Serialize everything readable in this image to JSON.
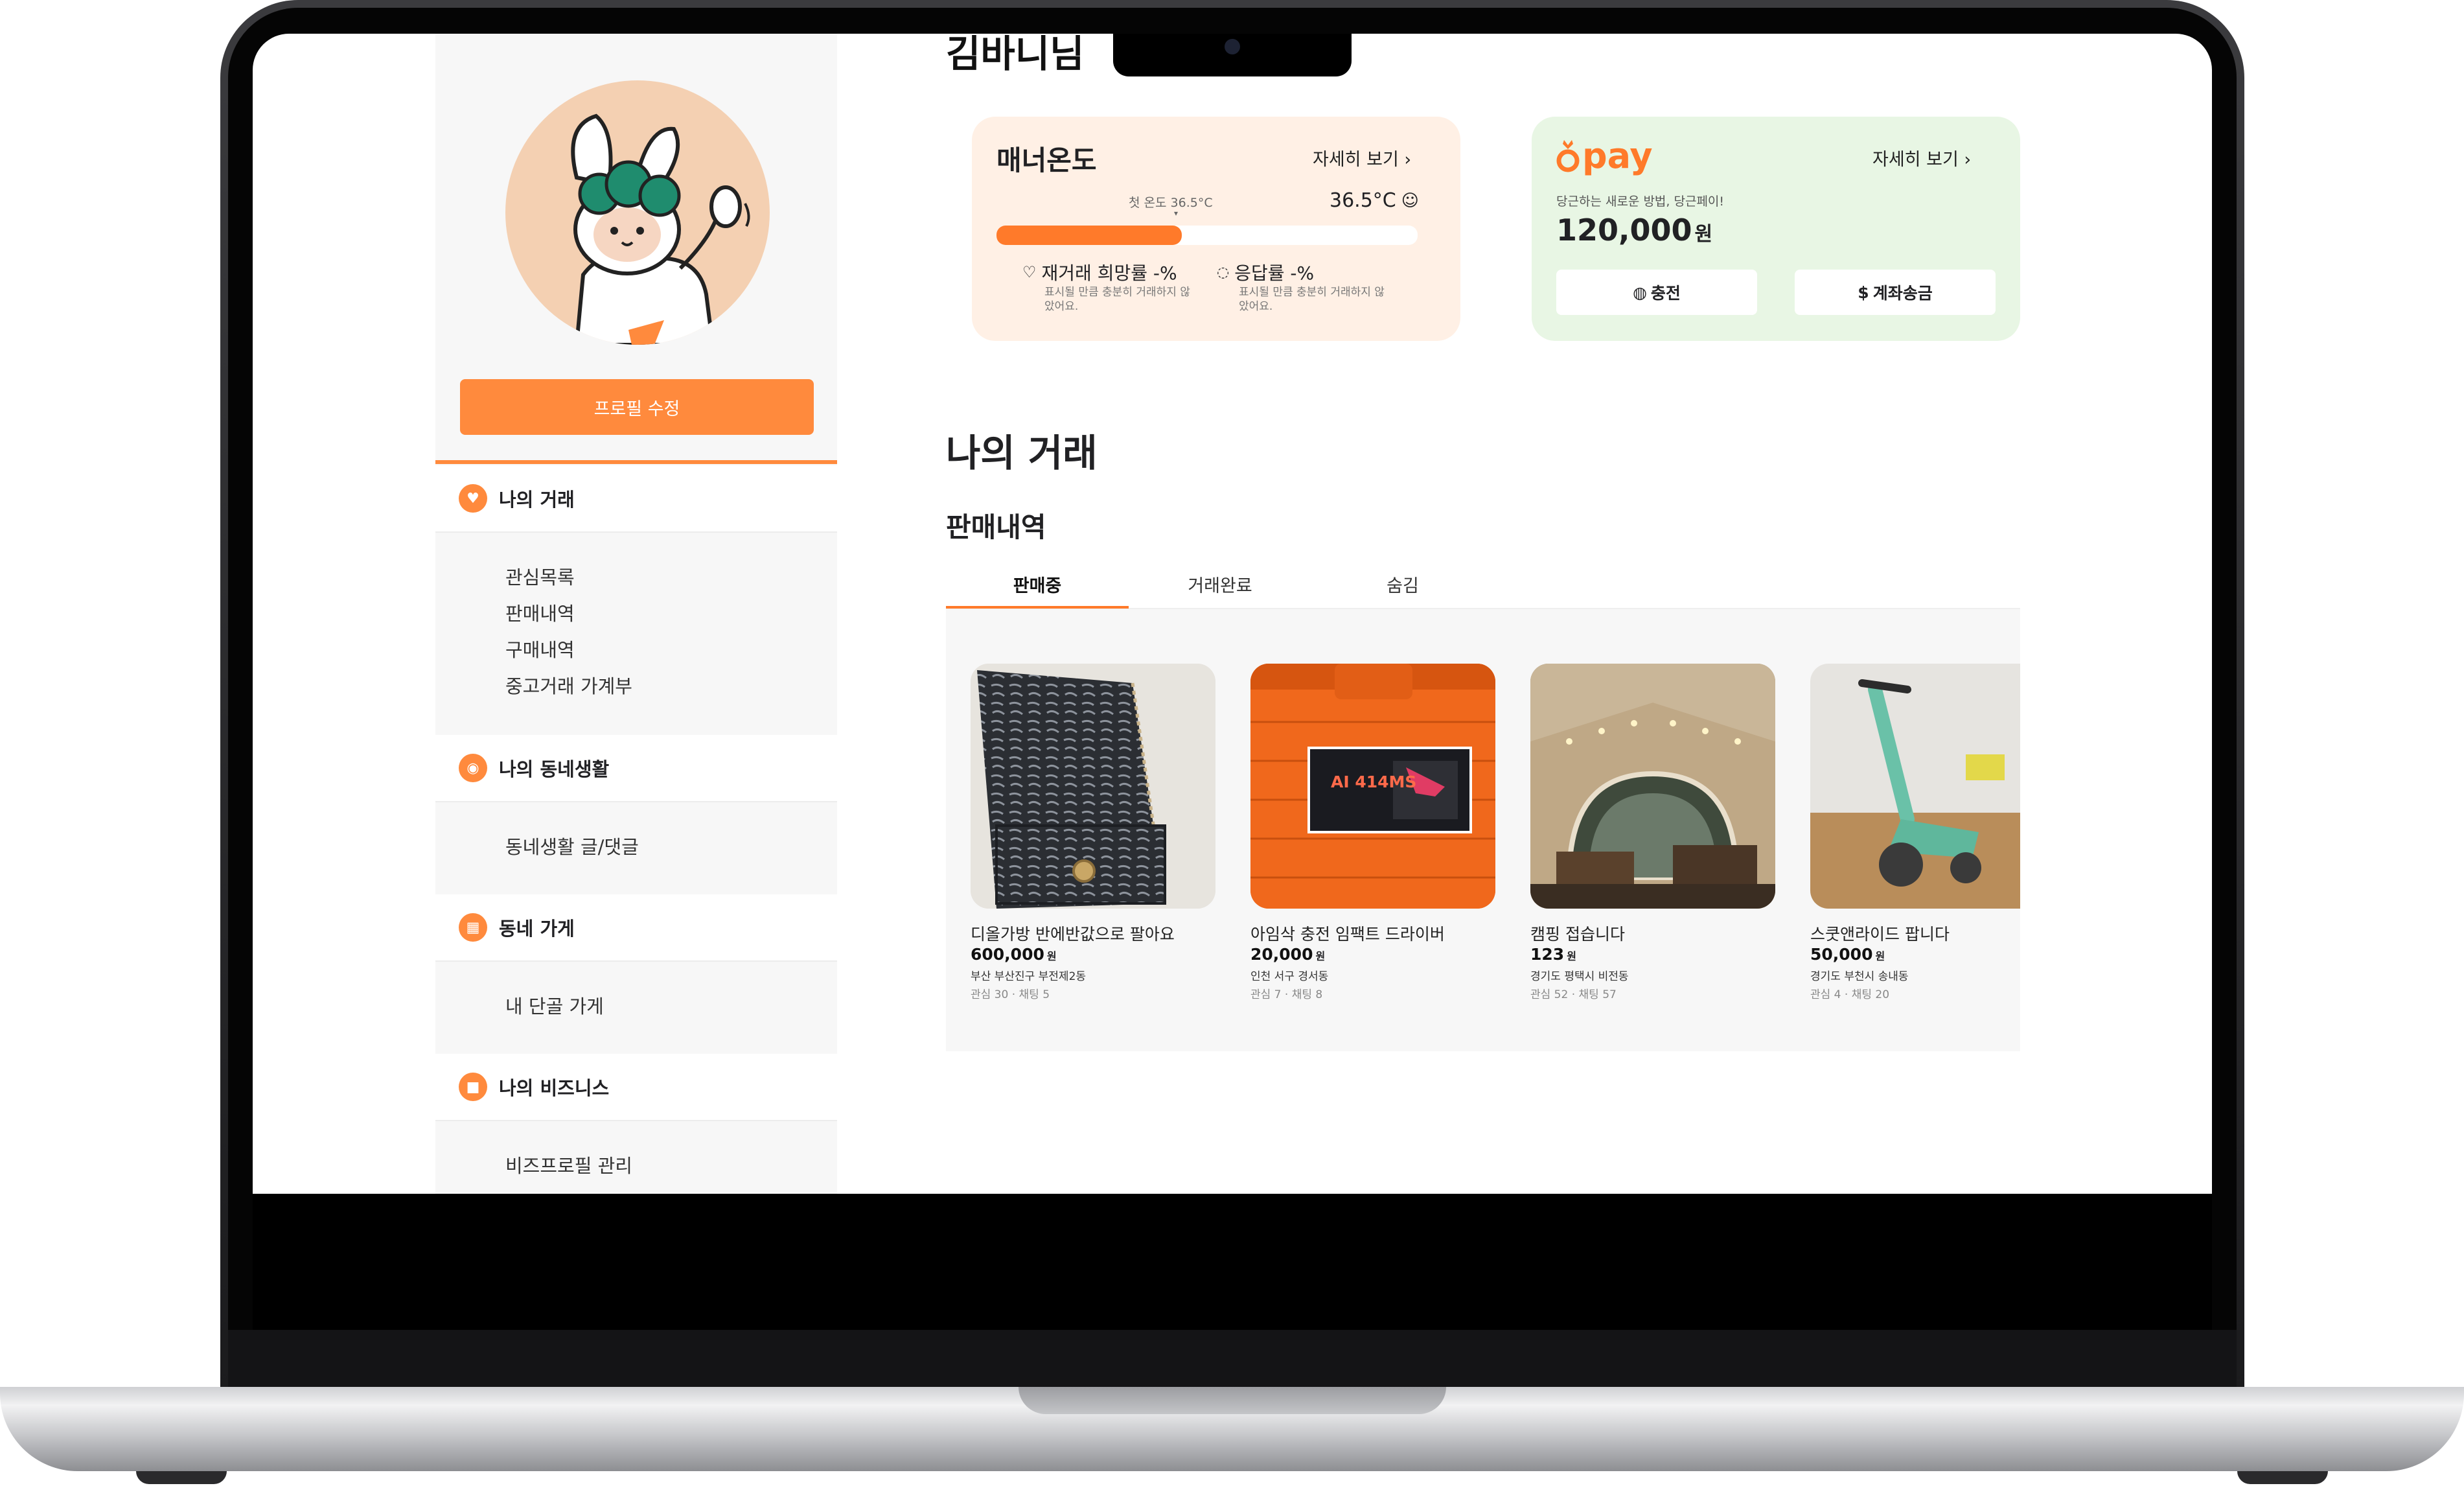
{
  "profile": {
    "greeting": "김바니님",
    "edit_button": "프로필 수정"
  },
  "sidebar": {
    "sections": [
      {
        "title": "나의 거래",
        "items": [
          "관심목록",
          "판매내역",
          "구매내역",
          "중고거래 가계부"
        ]
      },
      {
        "title": "나의 동네생활",
        "items": [
          "동네생활 글/댓글"
        ]
      },
      {
        "title": "동네 가게",
        "items": [
          "내 단골 가게"
        ]
      },
      {
        "title": "나의 비즈니스",
        "items": [
          "비즈프로필 관리"
        ]
      }
    ]
  },
  "manner": {
    "title": "매너온도",
    "more": "자세히 보기",
    "first_temp_label": "첫 온도 36.5°C",
    "temperature": "36.5°C",
    "temperature_level": 0.44,
    "rebuy_label": "재거래 희망률 -%",
    "rebuy_note": "표시될 만큼 충분히 거래하지 않았어요.",
    "response_label": "응답률 -%",
    "response_note": "표시될 만큼 충분히 거래하지 않았어요."
  },
  "pay": {
    "logo": "pay",
    "more": "자세히 보기",
    "tagline": "당근하는 새로운 방법, 당근페이!",
    "balance": "120,000",
    "currency": "원",
    "charge_button": "충전",
    "transfer_button": "계좌송금"
  },
  "trades": {
    "section_title": "나의 거래",
    "sales_title": "판매내역",
    "tabs": [
      "판매중",
      "거래완료",
      "숨김"
    ],
    "active_tab": 0,
    "listings": [
      {
        "title": "디올가방 반에반값으로 팔아요",
        "price": "600,000",
        "unit": "원",
        "location": "부산 부산진구 부전제2동",
        "meta": "관심 30 · 채팅 5",
        "image": "bag-image"
      },
      {
        "title": "아임삭 충전 임팩트 드라이버",
        "price": "20,000",
        "unit": "원",
        "location": "인천 서구 경서동",
        "meta": "관심 7 · 채팅 8",
        "image": "drill-case-image"
      },
      {
        "title": "캠핑 접습니다",
        "price": "123",
        "unit": "원",
        "location": "경기도 평택시 비전동",
        "meta": "관심 52 · 채팅 57",
        "image": "tent-image"
      },
      {
        "title": "스쿳앤라이드 팝니다",
        "price": "50,000",
        "unit": "원",
        "location": "경기도 부천시 송내동",
        "meta": "관심 4 · 채팅 20",
        "image": "scooter-image"
      }
    ],
    "drill_box_text": "AI 414MS"
  },
  "colors": {
    "accent": "#ff8a3d",
    "manner_bg": "#fff0e5",
    "pay_bg": "#e8f6e4"
  }
}
